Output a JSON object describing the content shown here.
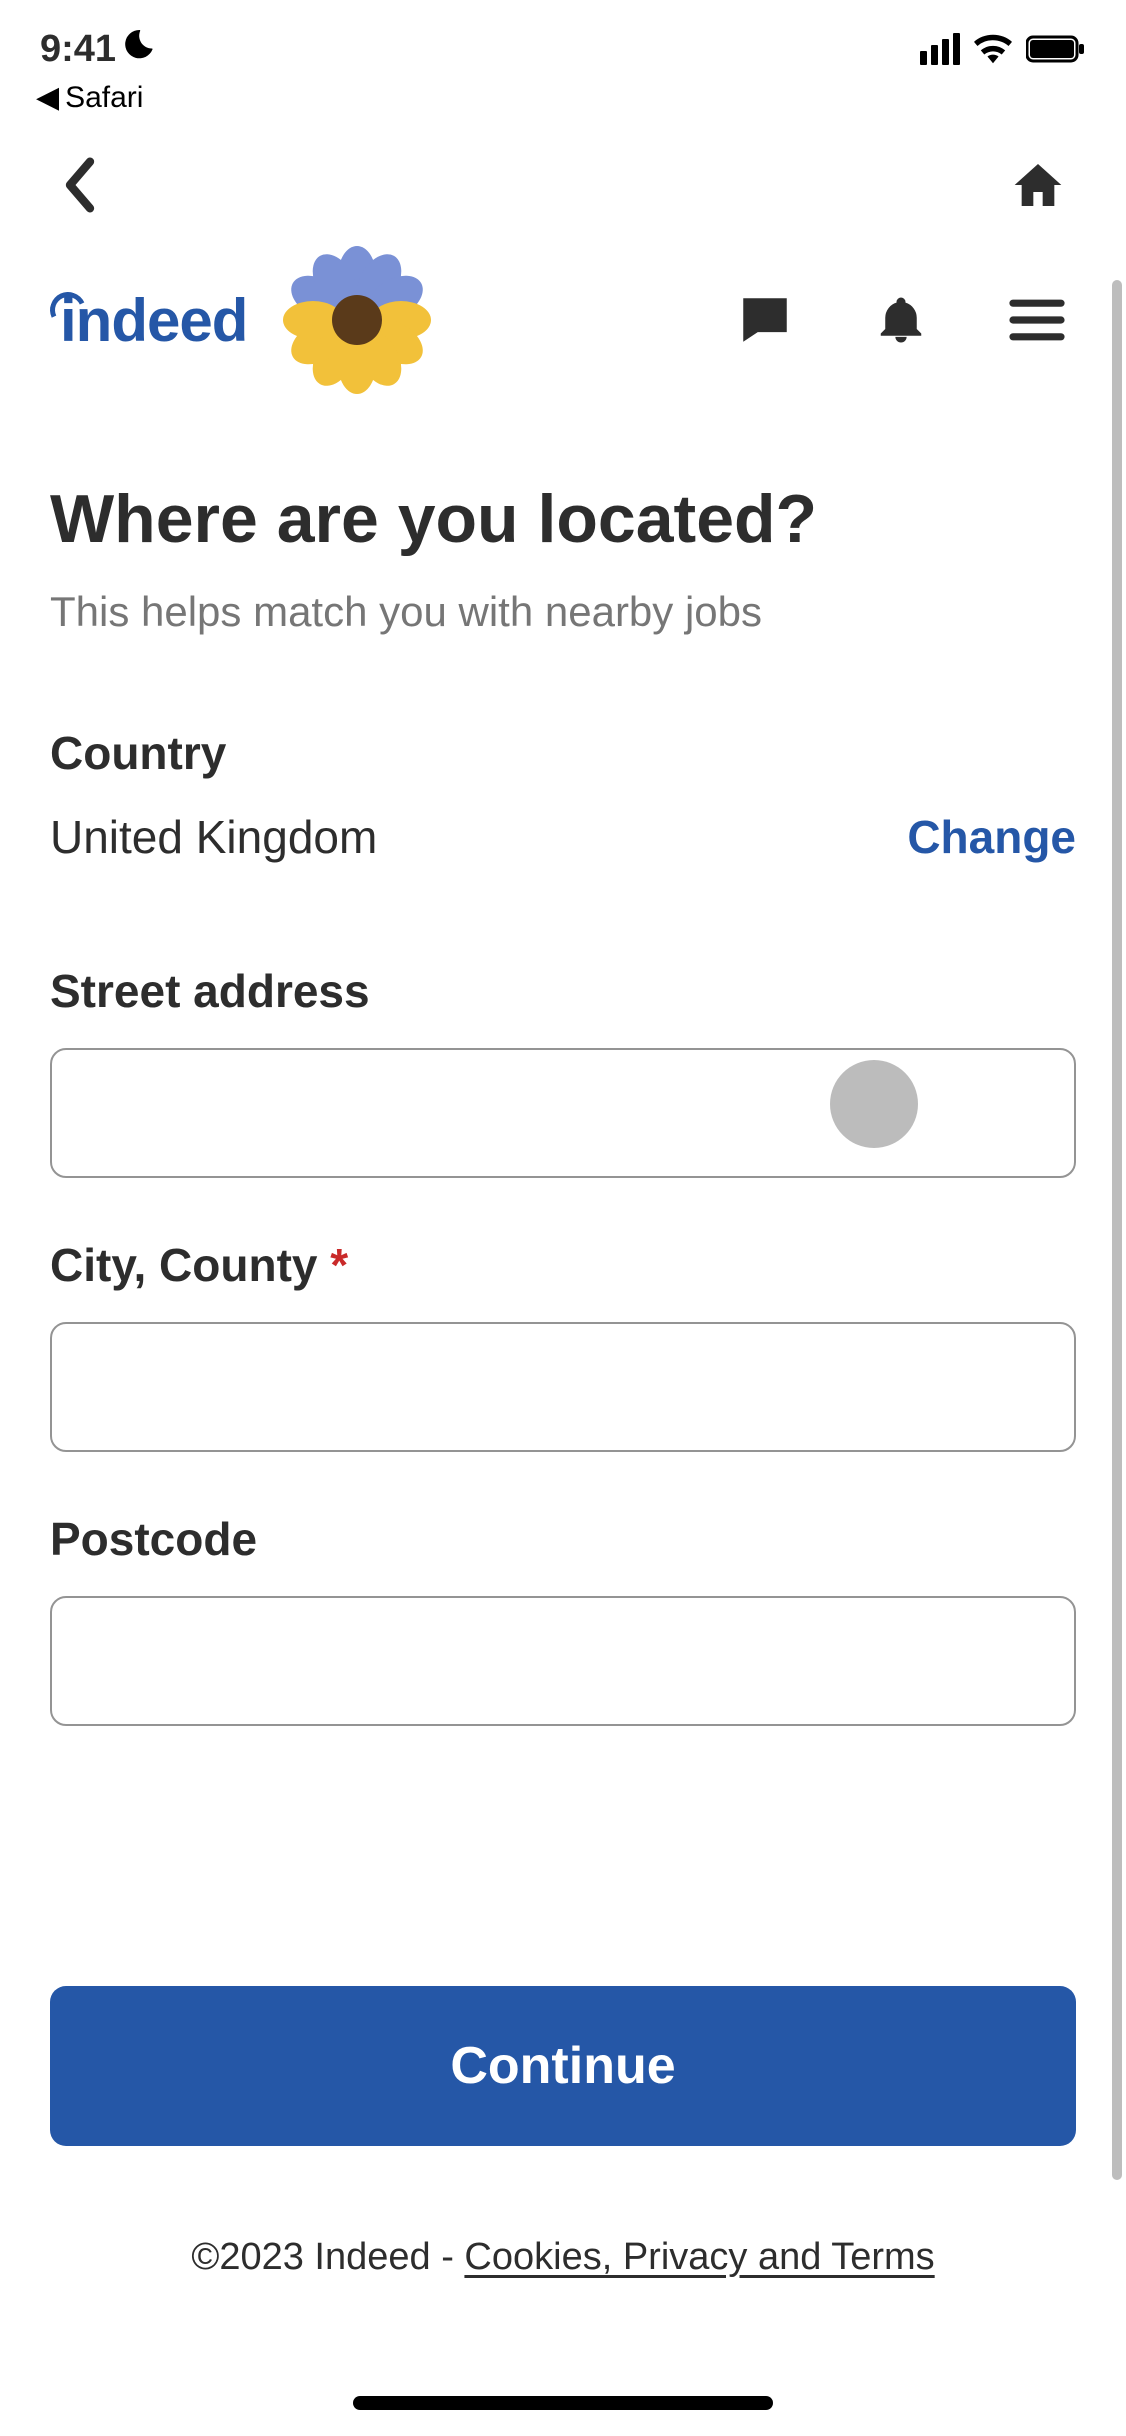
{
  "status_bar": {
    "time": "9:41",
    "back_app": "Safari"
  },
  "header": {
    "logo_text": "indeed"
  },
  "page": {
    "title": "Where are you located?",
    "subtitle": "This helps match you with nearby jobs"
  },
  "form": {
    "country_label": "Country",
    "country_value": "United Kingdom",
    "change_label": "Change",
    "street_label": "Street address",
    "street_value": "",
    "city_label": "City, County",
    "city_value": "",
    "postcode_label": "Postcode",
    "postcode_value": ""
  },
  "actions": {
    "continue_label": "Continue"
  },
  "footer": {
    "copyright": "©2023 Indeed - ",
    "links_label": "Cookies, Privacy and Terms"
  }
}
